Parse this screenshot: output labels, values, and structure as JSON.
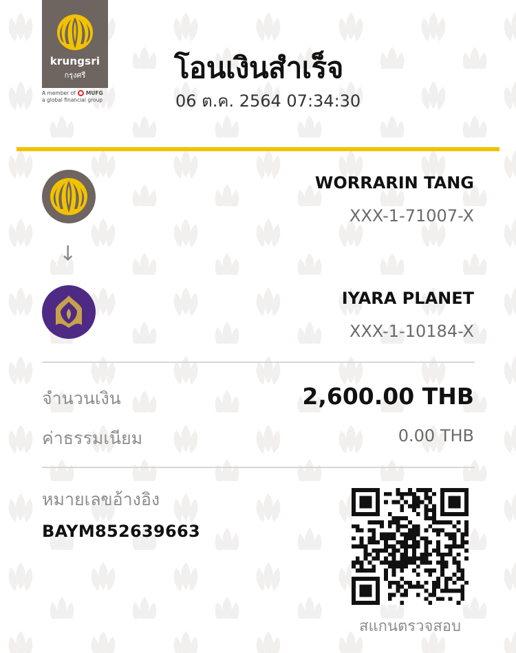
{
  "brand": {
    "name": "krungsri",
    "thai_name": "กรุงศรี",
    "member_prefix": "A member of",
    "member_brand": "MUFG",
    "member_sub": "a global financial group",
    "colors": {
      "brand_gray": "#6e6560",
      "brand_yellow": "#f2c200",
      "scb_purple": "#4e2a84",
      "mufg_red": "#e8222b"
    }
  },
  "header": {
    "title": "โอนเงินสำเร็จ",
    "datetime": "06 ต.ค. 2564 07:34:30"
  },
  "sender": {
    "name": "WORRARIN TANG",
    "account": "XXX-1-71007-X",
    "bank_icon": "krungsri-logo-icon"
  },
  "transfer_arrow": "↓",
  "receiver": {
    "name": "IYARA PLANET",
    "account": "XXX-1-10184-X",
    "bank_icon": "scb-logo-icon"
  },
  "amount": {
    "label": "จำนวนเงิน",
    "value": "2,600.00 THB"
  },
  "fee": {
    "label": "ค่าธรรมเนียม",
    "value": "0.00 THB"
  },
  "reference": {
    "label": "หมายเลขอ้างอิง",
    "value": "BAYM852639663"
  },
  "qr": {
    "caption": "สแกนตรวจสอบ"
  }
}
